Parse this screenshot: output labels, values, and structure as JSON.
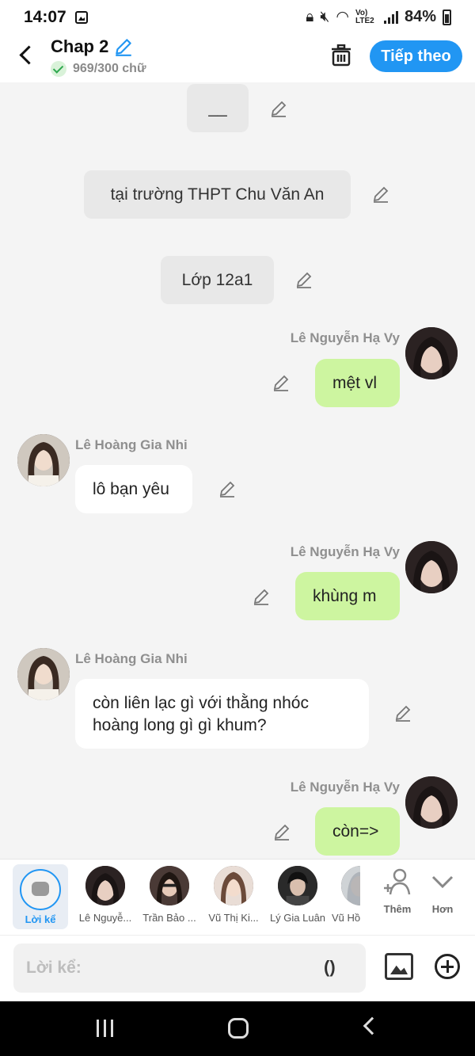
{
  "status_bar": {
    "time": "14:07",
    "network": "Vo) LTE2",
    "battery": "84%"
  },
  "header": {
    "title": "Chap 2",
    "word_count": "969/300 chữ",
    "next_label": "Tiếp theo"
  },
  "narrations": [
    "__",
    "tại trường THPT Chu Văn An",
    "Lớp 12a1"
  ],
  "messages": [
    {
      "sender": "Lê Nguyễn Hạ Vy",
      "text": "mệt vl",
      "side": "right"
    },
    {
      "sender": "Lê Hoàng Gia Nhi",
      "text": "lô bạn yêu",
      "side": "left"
    },
    {
      "sender": "Lê Nguyễn Hạ Vy",
      "text": "khùng m",
      "side": "right"
    },
    {
      "sender": "Lê Hoàng Gia Nhi",
      "text": "còn liên lạc gì với thằng nhóc hoàng long gì gì khum?",
      "side": "left"
    },
    {
      "sender": "Lê Nguyễn Hạ Vy",
      "text": "còn=>",
      "side": "right"
    }
  ],
  "character_bar": {
    "narrator_label": "Lời kể",
    "characters": [
      "Lê Nguyễ...",
      "Trần Bảo ...",
      "Vũ Thị Ki...",
      "Lý Gia Luân",
      "Vũ Hồ"
    ],
    "add_label": "Thêm",
    "more_label": "Hơn"
  },
  "input": {
    "placeholder": "Lời kể:",
    "paren": "()"
  },
  "colors": {
    "accent": "#2196f3",
    "my_bubble": "#cdf5a0",
    "narration_bg": "#e8e8e8"
  }
}
